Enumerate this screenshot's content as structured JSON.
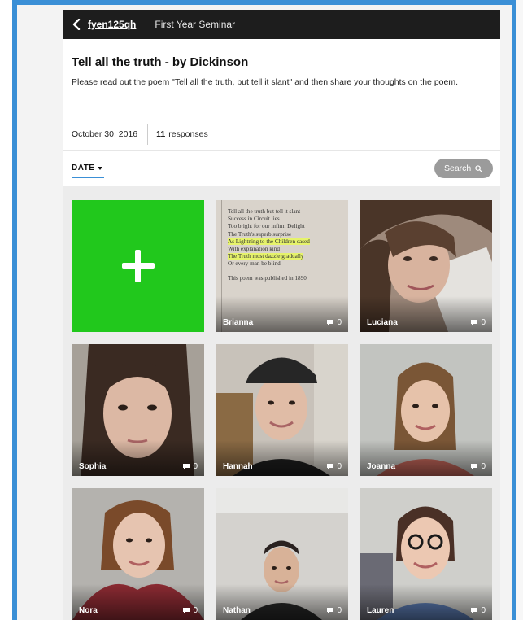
{
  "topbar": {
    "group": "fyen125qh",
    "course": "First Year Seminar"
  },
  "topic": {
    "title": "Tell all the truth - by Dickinson",
    "description": "Please read out the poem \"Tell all the truth, but tell it slant\" and then share your thoughts on the poem.",
    "date": "October 30, 2016",
    "responses_count": "11",
    "responses_label": "responses"
  },
  "filter": {
    "sort_label": "DATE",
    "search_label": "Search"
  },
  "poem_card": {
    "lines": [
      "Tell all the truth but tell it slant —",
      "Success in Circuit lies",
      "Too bright for our infirm Delight",
      "The Truth's superb surprise",
      "As Lightning to the Children eased",
      "With explanation kind",
      "The Truth must dazzle gradually",
      "Or every man be blind —"
    ],
    "footnote": "This poem was published in 1890"
  },
  "responses": [
    {
      "name": "Brianna",
      "comments": "0"
    },
    {
      "name": "Luciana",
      "comments": "0"
    },
    {
      "name": "Sophia",
      "comments": "0"
    },
    {
      "name": "Hannah",
      "comments": "0"
    },
    {
      "name": "Joanna",
      "comments": "0"
    },
    {
      "name": "Nora",
      "comments": "0"
    },
    {
      "name": "Nathan",
      "comments": "0"
    },
    {
      "name": "Lauren",
      "comments": "0"
    }
  ],
  "colors": {
    "accent": "#3a8fd6",
    "add_tile": "#21c81c",
    "topbar": "#1d1d1d"
  }
}
